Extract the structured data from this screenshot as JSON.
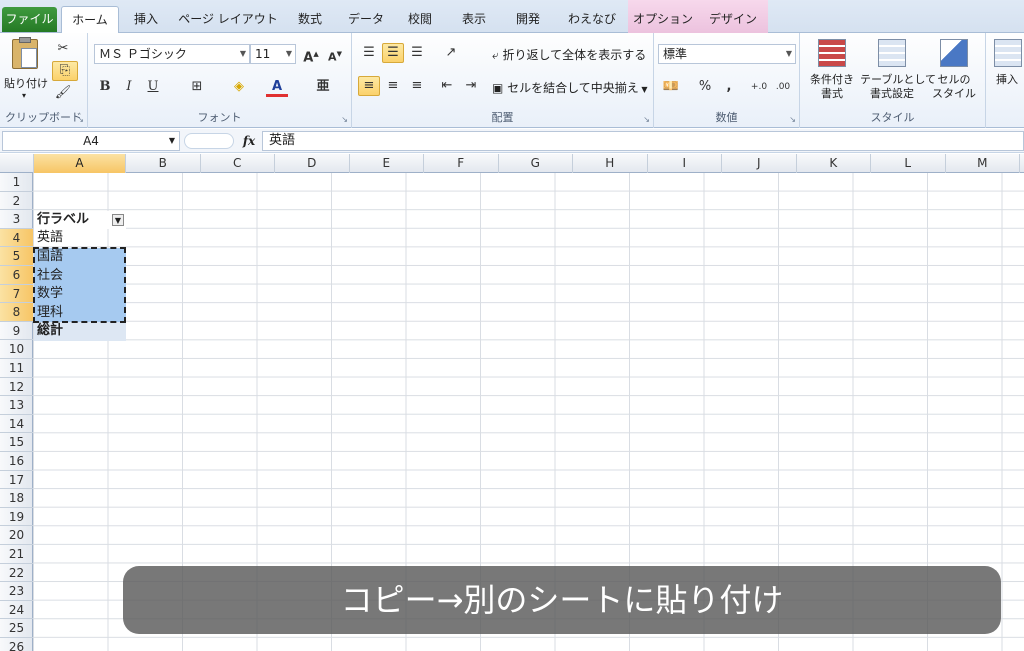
{
  "tabs": [
    "ファイル",
    "ホーム",
    "挿入",
    "ページ レイアウト",
    "数式",
    "データ",
    "校閲",
    "表示",
    "開発",
    "わえなび",
    "オプション",
    "デザイン"
  ],
  "ribbon": {
    "clipboard": {
      "label": "クリップボード",
      "paste": "貼り付け"
    },
    "font": {
      "label": "フォント",
      "font_name": "ＭＳ Ｐゴシック",
      "font_size": "11",
      "bold": "B",
      "italic": "I",
      "underline": "U",
      "font_color_glyph": "A"
    },
    "alignment": {
      "label": "配置",
      "wrap_text": "折り返して全体を表示する",
      "merge_center": "セルを結合して中央揃え"
    },
    "number": {
      "label": "数値",
      "format": "標準",
      "percent": "%",
      "comma": ","
    },
    "styles": {
      "label": "スタイル",
      "conditional": [
        "条件付き",
        "書式"
      ],
      "as_table": [
        "テーブルとして",
        "書式設定"
      ],
      "cell_style": [
        "セルの",
        "スタイル"
      ]
    },
    "cells": {
      "insert": "挿入"
    }
  },
  "formula_bar": {
    "name_box": "A4",
    "fx": "fx",
    "content": "英語"
  },
  "columns": [
    "A",
    "B",
    "C",
    "D",
    "E",
    "F",
    "G",
    "H",
    "I",
    "J",
    "K",
    "L",
    "M"
  ],
  "rows": [
    "1",
    "2",
    "3",
    "4",
    "5",
    "6",
    "7",
    "8",
    "9",
    "10",
    "11",
    "12",
    "13",
    "14",
    "15",
    "16",
    "17",
    "18",
    "19",
    "20",
    "21",
    "22",
    "23",
    "24",
    "25",
    "26"
  ],
  "cells": {
    "a3": "行ラベル",
    "a4": "英語",
    "a5": "国語",
    "a6": "社会",
    "a7": "数学",
    "a8": "理科",
    "a9": "総計"
  },
  "overlay_caption": "コピー→別のシートに貼り付け",
  "colors": {
    "accent_file_tab": "#2f8a2f",
    "context_tab": "#f1cce4",
    "selection": "#a6caf0",
    "header_selected": "#f9d27c"
  }
}
